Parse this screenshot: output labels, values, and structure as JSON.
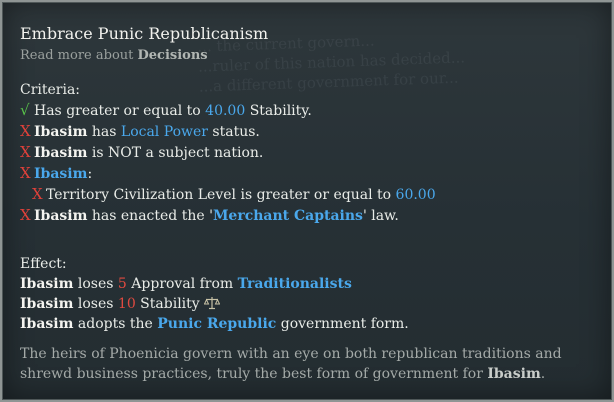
{
  "tooltip": {
    "title": "Embrace Punic Republicanism",
    "read_more": {
      "prefix": "Read more about ",
      "topic": "Decisions"
    },
    "ghost_lines": [
      "... the current govern...",
      "...ruler of this nation has decided...",
      "...a different government for our..."
    ],
    "criteria_label": "Criteria:",
    "criteria": [
      {
        "status": "pass",
        "mark": "√",
        "text1": "Has greater or equal to ",
        "value": "40.00",
        "text2": " Stability."
      },
      {
        "status": "fail",
        "mark": "X",
        "actor": "Ibasim",
        "text": " has ",
        "link": "Local Power",
        "text2": " status."
      },
      {
        "status": "fail",
        "mark": "X",
        "actor": "Ibasim",
        "text": " is NOT a subject nation."
      },
      {
        "status": "fail",
        "mark": "X",
        "link": "Ibasim",
        "text": ":"
      },
      {
        "status": "fail",
        "mark": "X",
        "text1": "Territory Civilization Level is greater or equal to ",
        "value": "60.00"
      },
      {
        "status": "fail",
        "mark": "X",
        "actor": "Ibasim",
        "text": " has enacted the '",
        "link": "Merchant Captains",
        "text2": "' law."
      }
    ],
    "effect_label": "Effect:",
    "effects": [
      {
        "actor": "Ibasim",
        "text1": " loses ",
        "num": "5",
        "text2": " Approval from ",
        "link": "Traditionalists"
      },
      {
        "actor": "Ibasim",
        "text1": " loses ",
        "num": "10",
        "text2": " Stability"
      },
      {
        "actor": "Ibasim",
        "text1": " adopts the ",
        "link": "Punic Republic",
        "text2": " government form."
      }
    ],
    "description": {
      "text": "The heirs of Phoenicia govern with an eye on both republican traditions and shrewd business practices, truly the best form of government for ",
      "actor": "Ibasim",
      "end": "."
    }
  }
}
